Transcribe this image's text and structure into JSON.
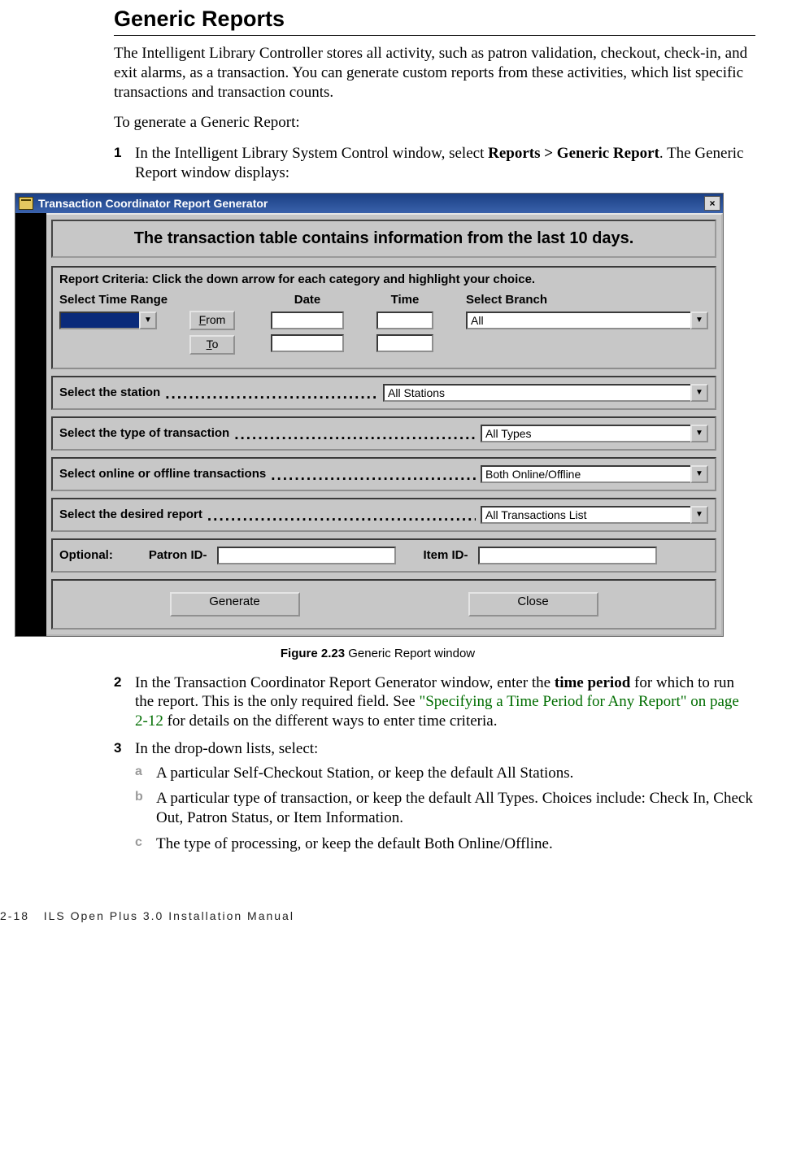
{
  "title": "Generic Reports",
  "intro": "The Intelligent Library Controller stores all activity, such as patron validation, checkout, check-in, and exit alarms, as a transaction. You can generate custom reports from these activities, which list specific transactions and transaction counts.",
  "lead_in": "To generate a Generic Report:",
  "step1": {
    "num": "1",
    "pre": "In the Intelligent Library System Control window, select ",
    "menu": "Reports > Generic Report",
    "post": ". The Generic Report window displays:"
  },
  "window": {
    "title": "Transaction Coordinator Report Generator",
    "banner": "The transaction table contains information from the last 10 days.",
    "criteria_heading": "Report Criteria:  Click the down arrow for each category and highlight your choice.",
    "time_range_label": "Select Time Range",
    "date_label": "Date",
    "time_label": "Time",
    "branch_label": "Select Branch",
    "from_label": "From",
    "to_label": "To",
    "branch_value": "All",
    "station_label": "Select the station",
    "station_value": "All Stations",
    "txn_type_label": "Select the type of transaction",
    "txn_type_value": "All Types",
    "online_label": "Select online or offline transactions",
    "online_value": "Both Online/Offline",
    "report_label": "Select the desired report",
    "report_value": "All Transactions List",
    "optional_label": "Optional:",
    "patron_label": "Patron ID-",
    "item_label": "Item ID-",
    "generate_btn": "Generate",
    "close_btn": "Close",
    "close_x": "×"
  },
  "figure": {
    "label": "Figure 2.23",
    "caption": " Generic Report window"
  },
  "step2": {
    "num": "2",
    "pre": "In the Transaction Coordinator Report Generator window, enter the ",
    "bold": "time period",
    "mid": " for which to run the report. This is the only required field. See ",
    "xref": "\"Specifying a Time Period for Any Report\" on page 2-12",
    "post": " for details on the different ways to enter time criteria."
  },
  "step3": {
    "num": "3",
    "text": "In the drop-down lists, select:",
    "a": {
      "letter": "a",
      "text": "A particular Self-Checkout Station, or keep the default All Stations."
    },
    "b": {
      "letter": "b",
      "text": "A particular type of transaction, or keep the default All Types. Choices include: Check In, Check Out, Patron Status, or Item Information."
    },
    "c": {
      "letter": "c",
      "text": "The type of processing, or keep the default Both Online/Offline."
    }
  },
  "footer": {
    "page_num": "2-18",
    "book": "ILS Open Plus 3.0 Installation Manual"
  }
}
